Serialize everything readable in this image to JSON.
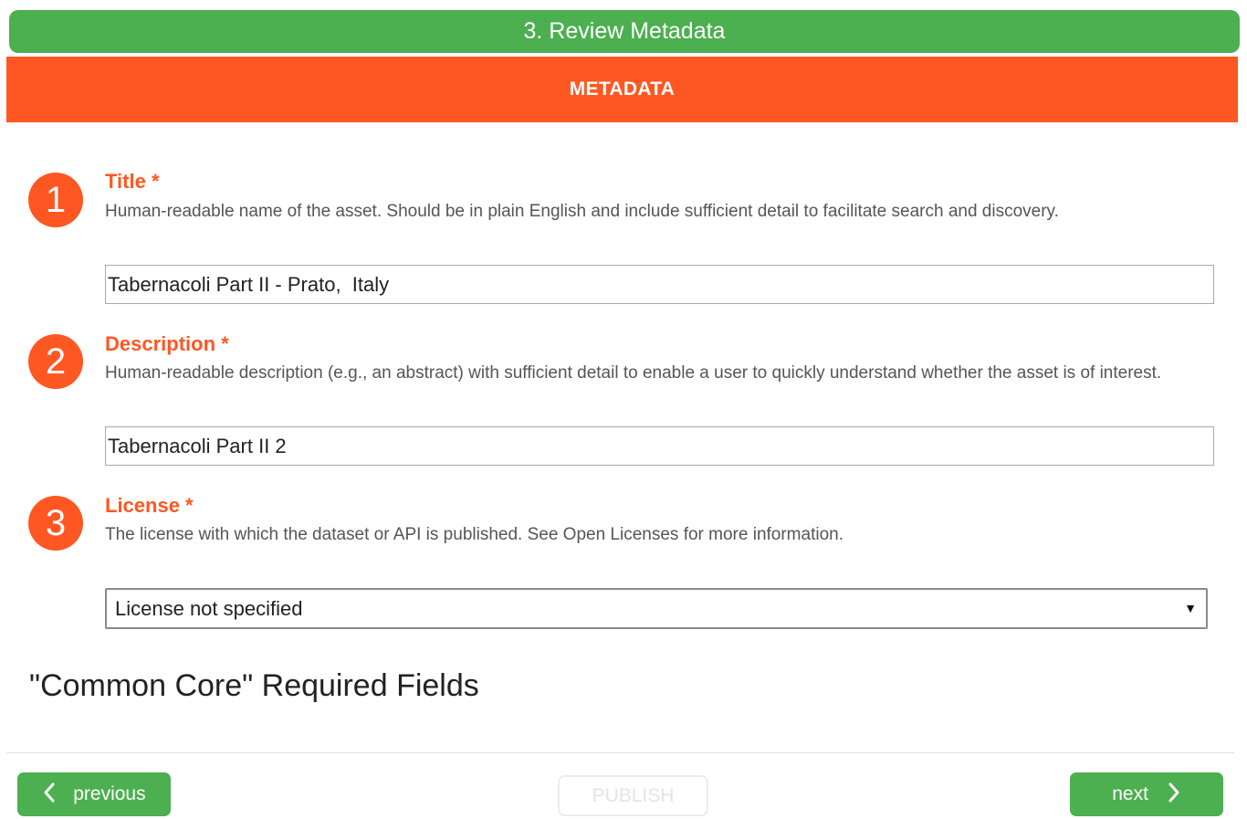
{
  "header": {
    "step_title": "3. Review Metadata",
    "section_title": "METADATA"
  },
  "fields": [
    {
      "number": "1",
      "label": "Title *",
      "help": "Human-readable name of the asset. Should be in plain English and include sufficient detail to facilitate search and discovery.",
      "value": "Tabernacoli Part II - Prato,  Italy"
    },
    {
      "number": "2",
      "label": "Description *",
      "help": "Human-readable description (e.g., an abstract) with sufficient detail to enable a user to quickly understand whether the asset is of interest.",
      "value": "Tabernacoli Part II 2"
    },
    {
      "number": "3",
      "label": "License *",
      "help": "The license with which the dataset or API is published. See Open Licenses for more information.",
      "selected": "License not specified"
    }
  ],
  "common_core_heading": "\"Common Core\" Required Fields",
  "footer": {
    "previous_label": "previous",
    "publish_label": "PUBLISH",
    "next_label": "next"
  },
  "icons": {
    "previous": "chevron-left-icon",
    "next": "chevron-right-icon",
    "dropdown": "caret-down-icon"
  },
  "colors": {
    "green": "#4caf50",
    "orange": "#ff5722"
  }
}
